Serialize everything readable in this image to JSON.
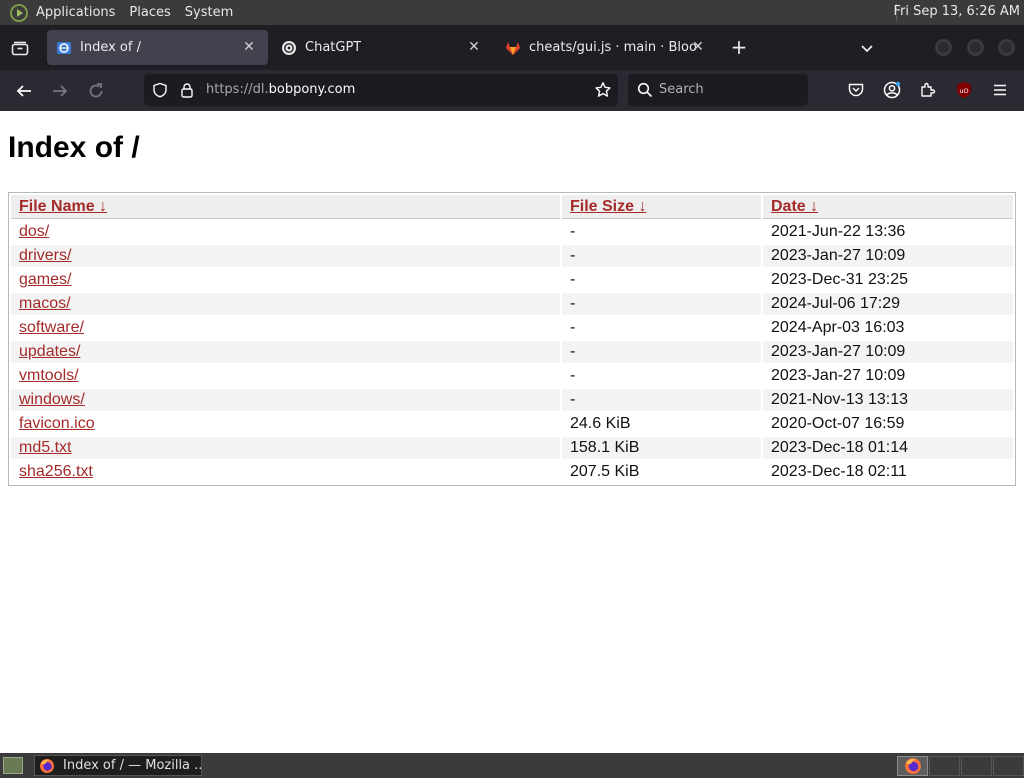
{
  "top_panel": {
    "menus": [
      "Applications",
      "Places",
      "System"
    ],
    "clock": "Fri Sep 13,  6:26 AM"
  },
  "tabs": [
    {
      "title": "Index of /",
      "active": true
    },
    {
      "title": "ChatGPT",
      "active": false
    },
    {
      "title": "cheats/gui.js · main · Blooket",
      "active": false
    }
  ],
  "navbar": {
    "url_prefix": "https://dl.",
    "url_domain": "bobpony.com",
    "search_placeholder": "Search"
  },
  "page": {
    "title": "Index of /",
    "headers": {
      "name": "File Name  ↓",
      "size": "File Size  ↓",
      "date": "Date  ↓"
    },
    "rows": [
      {
        "name": "dos/",
        "size": "-",
        "date": "2021-Jun-22 13:36"
      },
      {
        "name": "drivers/",
        "size": "-",
        "date": "2023-Jan-27 10:09"
      },
      {
        "name": "games/",
        "size": "-",
        "date": "2023-Dec-31 23:25"
      },
      {
        "name": "macos/",
        "size": "-",
        "date": "2024-Jul-06 17:29"
      },
      {
        "name": "software/",
        "size": "-",
        "date": "2024-Apr-03 16:03"
      },
      {
        "name": "updates/",
        "size": "-",
        "date": "2023-Jan-27 10:09"
      },
      {
        "name": "vmtools/",
        "size": "-",
        "date": "2023-Jan-27 10:09"
      },
      {
        "name": "windows/",
        "size": "-",
        "date": "2021-Nov-13 13:13"
      },
      {
        "name": "favicon.ico",
        "size": "24.6 KiB",
        "date": "2020-Oct-07 16:59"
      },
      {
        "name": "md5.txt",
        "size": "158.1 KiB",
        "date": "2023-Dec-18 01:14"
      },
      {
        "name": "sha256.txt",
        "size": "207.5 KiB",
        "date": "2023-Dec-18 02:11"
      }
    ]
  },
  "taskbar": {
    "window_title": "Index of / — Mozilla ..."
  },
  "colors": {
    "link": "#a52a2a",
    "panel": "#3b3b3b",
    "tabbar": "#1f1e25",
    "navbar": "#2b2a33",
    "active_tab": "#42414d"
  }
}
